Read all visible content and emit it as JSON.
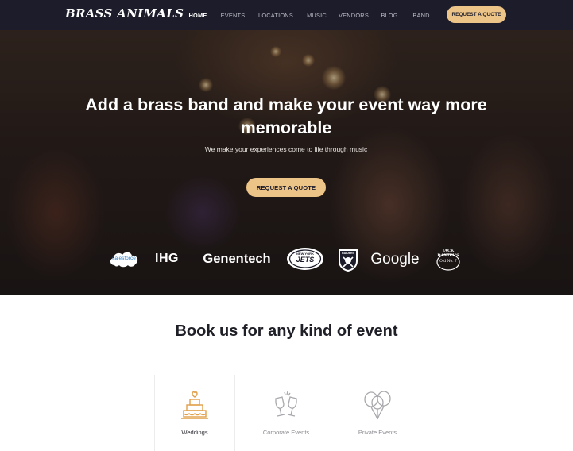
{
  "nav": {
    "logo": "BRASS ANIMALS",
    "links": [
      {
        "label": "HOME",
        "active": true
      },
      {
        "label": "EVENTS",
        "active": false
      },
      {
        "label": "LOCATIONS",
        "active": false
      },
      {
        "label": "MUSIC",
        "active": false
      },
      {
        "label": "VENDORS",
        "active": false
      },
      {
        "label": "BLOG",
        "active": false
      },
      {
        "label": "BAND",
        "active": false
      }
    ],
    "cta": "REQUEST A QUOTE"
  },
  "hero": {
    "title": "Add a brass band and make your event way more memorable",
    "subtitle": "We make your experiences come to life through music",
    "cta": "REQUEST A QUOTE"
  },
  "clients": {
    "salesforce": "salesforce",
    "ihg": "IHG",
    "genentech": "Genentech",
    "jets_top": "NEW YORK",
    "jets": "JETS",
    "raiders": "RAIDERS",
    "google": "Google",
    "jack_daniels": "JACK DANIEL'S",
    "jack_daniels_badge": "Old No. 7"
  },
  "services": {
    "title": "Book us for any kind of event",
    "items": [
      {
        "label": "Weddings",
        "icon": "wedding-cake-icon",
        "active": true
      },
      {
        "label": "Corporate Events",
        "icon": "champagne-toast-icon",
        "active": false
      },
      {
        "label": "Private Events",
        "icon": "balloons-icon",
        "active": false
      }
    ]
  },
  "colors": {
    "nav_bg": "#1c1c2a",
    "accent": "#edc488",
    "icon_active": "#e0a04a",
    "icon_inactive": "#a8a8ad"
  }
}
